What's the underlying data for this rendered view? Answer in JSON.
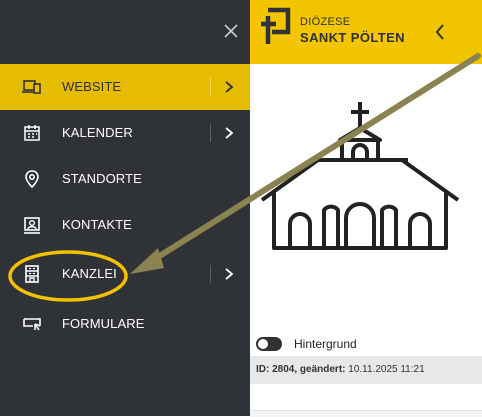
{
  "sidebar": {
    "items": [
      {
        "label": "WEBSITE",
        "icon": "devices-icon",
        "has_submenu": true,
        "active": true
      },
      {
        "label": "KALENDER",
        "icon": "calendar-icon",
        "has_submenu": true,
        "active": false
      },
      {
        "label": "STANDORTE",
        "icon": "location-pin-icon",
        "has_submenu": false,
        "active": false
      },
      {
        "label": "KONTAKTE",
        "icon": "contact-card-icon",
        "has_submenu": false,
        "active": false
      },
      {
        "label": "KANZLEI",
        "icon": "office-building-icon",
        "has_submenu": true,
        "active": false
      },
      {
        "label": "FORMULARE",
        "icon": "form-icon",
        "has_submenu": false,
        "active": false
      }
    ]
  },
  "header": {
    "brand_line1": "DIÖZESE",
    "brand_line2": "SANKT PÖLTEN"
  },
  "content": {
    "toggle_label": "Hintergrund",
    "meta_prefix": "ID: 2804, geändert:",
    "meta_value": "10.11.2025 11:21"
  },
  "colors": {
    "sidebar_bg": "#2f3237",
    "accent": "#e5bc00",
    "annotation_arrow": "#8a8250",
    "annotation_ring": "#f2c200"
  }
}
